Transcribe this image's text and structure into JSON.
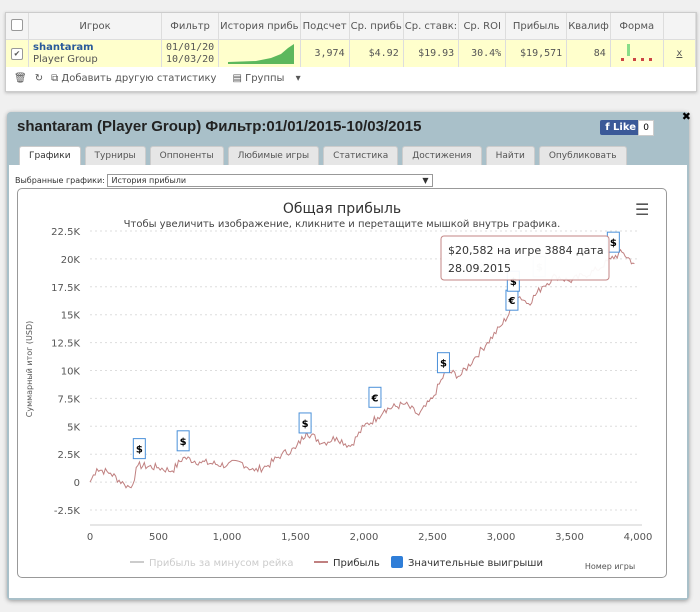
{
  "table": {
    "headers": [
      "Игрок",
      "Фильтр",
      "История прибь",
      "Подсчет",
      "Ср. прибь",
      "Ср. ставк:",
      "Ср. ROI",
      "Прибыль",
      "Квалиф",
      "Форма"
    ],
    "row": {
      "player": "shantaram",
      "group": "Player Group",
      "filter_from": "01/01/20",
      "filter_to": "10/03/20",
      "count": "3,974",
      "avg_profit": "$4.92",
      "avg_stake": "$19.93",
      "roi": "30.4%",
      "profit": "$19,571",
      "qual": "84",
      "remove": "x"
    }
  },
  "toolbar": {
    "add_stat": "Добавить другую статистику",
    "groups": "Группы"
  },
  "window": {
    "title": "shantaram (Player Group) Фильтр:01/01/2015-10/03/2015",
    "like": "Like",
    "like_count": "0",
    "tabs": [
      "Графики",
      "Турниры",
      "Оппоненты",
      "Любимые игры",
      "Статистика",
      "Достижения",
      "Найти",
      "Опубликовать"
    ],
    "selected_label": "Выбранные графики:",
    "selected_value": "История прибыли"
  },
  "chart_data": {
    "type": "line",
    "title": "Общая прибыль",
    "subtitle": "Чтобы увеличить изображение, кликните и перетащите мышкой внутрь графика.",
    "ylabel": "Суммарный итог (USD)",
    "xlabel": "Номер игры",
    "ylim": [
      -2500,
      22500
    ],
    "xlim": [
      0,
      4000
    ],
    "yticks": [
      "-2.5K",
      "0",
      "2.5K",
      "5K",
      "7.5K",
      "10K",
      "12.5K",
      "15K",
      "17.5K",
      "20K",
      "22.5K"
    ],
    "xticks": [
      "0",
      "500",
      "1,000",
      "1,500",
      "2,000",
      "2,500",
      "3,000",
      "3,500",
      "4,000"
    ],
    "legend": [
      "Прибыль за минусом рейка",
      "Прибыль",
      "Значительные выигрыши"
    ],
    "series": [
      {
        "name": "Прибыль",
        "color": "#c08080",
        "points": [
          [
            0,
            0
          ],
          [
            50,
            1200
          ],
          [
            150,
            800
          ],
          [
            250,
            -200
          ],
          [
            300,
            -500
          ],
          [
            350,
            1500
          ],
          [
            500,
            1300
          ],
          [
            600,
            1000
          ],
          [
            680,
            2200
          ],
          [
            800,
            1800
          ],
          [
            1000,
            1500
          ],
          [
            1100,
            1800
          ],
          [
            1200,
            1000
          ],
          [
            1300,
            1500
          ],
          [
            1400,
            2500
          ],
          [
            1500,
            3000
          ],
          [
            1580,
            4500
          ],
          [
            1700,
            3500
          ],
          [
            1800,
            4000
          ],
          [
            1900,
            3200
          ],
          [
            2000,
            5000
          ],
          [
            2100,
            5800
          ],
          [
            2150,
            6500
          ],
          [
            2300,
            7000
          ],
          [
            2400,
            6000
          ],
          [
            2500,
            7500
          ],
          [
            2600,
            10000
          ],
          [
            2700,
            9500
          ],
          [
            2800,
            11000
          ],
          [
            2900,
            12500
          ],
          [
            3000,
            14000
          ],
          [
            3080,
            15500
          ],
          [
            3100,
            17000
          ],
          [
            3200,
            16000
          ],
          [
            3300,
            17500
          ],
          [
            3400,
            18500
          ],
          [
            3500,
            18000
          ],
          [
            3600,
            18500
          ],
          [
            3700,
            19000
          ],
          [
            3800,
            20000
          ],
          [
            3884,
            20582
          ],
          [
            3974,
            19571
          ]
        ]
      }
    ],
    "big_wins": [
      [
        360,
        3000,
        "$"
      ],
      [
        680,
        3700,
        "$"
      ],
      [
        1570,
        5300,
        "$"
      ],
      [
        2080,
        7600,
        "€"
      ],
      [
        2580,
        10700,
        "$"
      ],
      [
        3080,
        16300,
        "€"
      ],
      [
        3090,
        18000,
        "$"
      ],
      [
        3280,
        19300,
        "$"
      ],
      [
        3820,
        21500,
        "$"
      ]
    ],
    "tooltip": {
      "line1": "$20,582 на игре 3884 дата",
      "line2": "28.09.2015"
    }
  }
}
